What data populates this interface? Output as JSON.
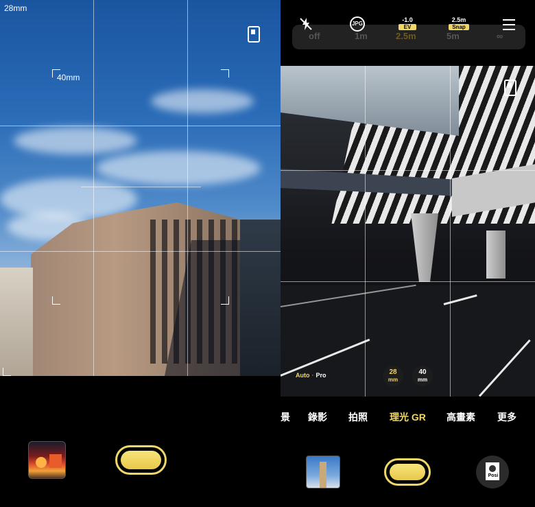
{
  "left": {
    "focal_readout": "28mm",
    "frame_label": "40mm",
    "icons": {
      "aspect_ratio": "aspect-ratio-icon",
      "gallery": "gallery-thumbnail"
    },
    "shutter": "shutter-button"
  },
  "right": {
    "top_bar": {
      "flash": "flash-off-icon",
      "format": "JPG",
      "ev_value": "-1.0",
      "ev_badge": "EV",
      "snap_value": "2.5m",
      "snap_badge": "Snap",
      "menu": "menu-icon"
    },
    "snap_distances": [
      "off",
      "1m",
      "2.5m",
      "5m",
      "∞"
    ],
    "snap_active": "2.5m",
    "mode_toggle": {
      "auto": "Auto",
      "pro": "Pro"
    },
    "lenses": [
      {
        "value": "28",
        "unit": "mm",
        "active": true
      },
      {
        "value": "40",
        "unit": "mm",
        "active": false
      }
    ],
    "modes": [
      "景",
      "錄影",
      "拍照",
      "理光 GR",
      "高畫素",
      "更多"
    ],
    "active_mode": "理光 GR",
    "posi_label": "Posi"
  },
  "colors": {
    "accent": "#f0d76a",
    "background": "#000000"
  }
}
